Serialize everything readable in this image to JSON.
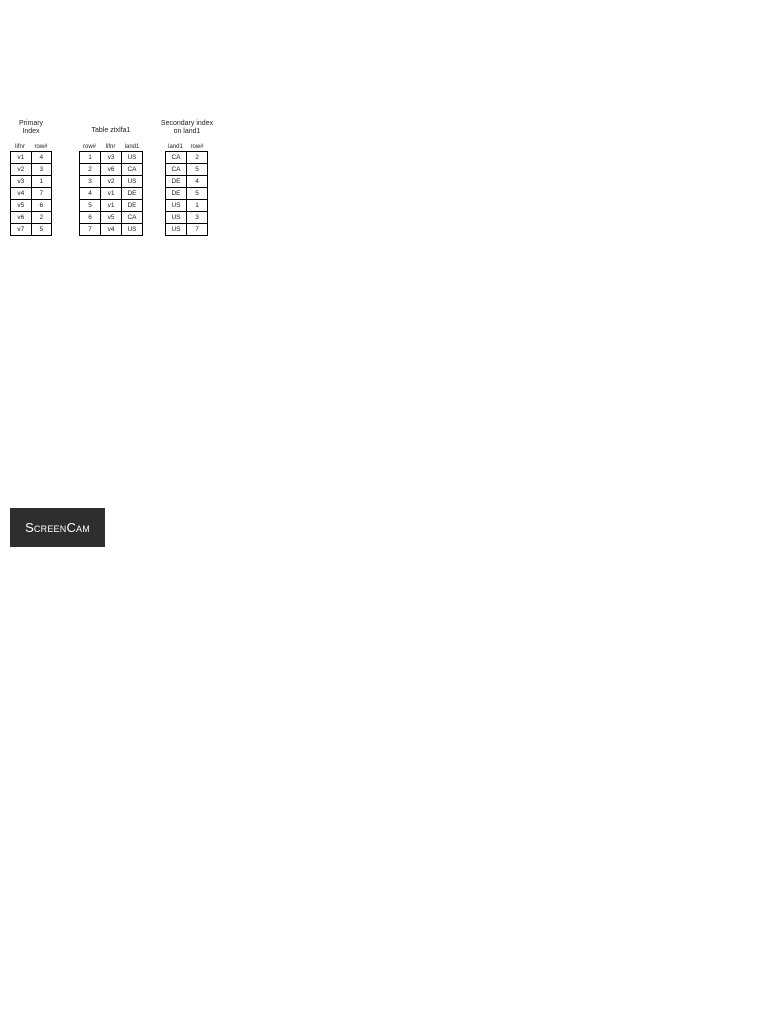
{
  "primary_index": {
    "title": "Primary\nIndex",
    "headers": [
      "lifnr",
      "row#"
    ],
    "rows": [
      [
        "v1",
        "4"
      ],
      [
        "v2",
        "3"
      ],
      [
        "v3",
        "1"
      ],
      [
        "v4",
        "7"
      ],
      [
        "v5",
        "6"
      ],
      [
        "v6",
        "2"
      ],
      [
        "v7",
        "5"
      ]
    ]
  },
  "table": {
    "title": "Table ztxlfa1",
    "headers": [
      "row#",
      "lifnr",
      "land1"
    ],
    "rows": [
      [
        "1",
        "v3",
        "US"
      ],
      [
        "2",
        "v6",
        "CA"
      ],
      [
        "3",
        "v2",
        "US"
      ],
      [
        "4",
        "v1",
        "DE"
      ],
      [
        "5",
        "v1",
        "DE"
      ],
      [
        "6",
        "v5",
        "CA"
      ],
      [
        "7",
        "v4",
        "US"
      ]
    ]
  },
  "secondary_index": {
    "title": "Secondary index\non land1",
    "headers": [
      "land1",
      "row#"
    ],
    "rows": [
      [
        "CA",
        "2"
      ],
      [
        "CA",
        "5"
      ],
      [
        "DE",
        "4"
      ],
      [
        "DE",
        "5"
      ],
      [
        "US",
        "1"
      ],
      [
        "US",
        "3"
      ],
      [
        "US",
        "7"
      ]
    ]
  },
  "logo": {
    "text": "ScreenCam"
  }
}
